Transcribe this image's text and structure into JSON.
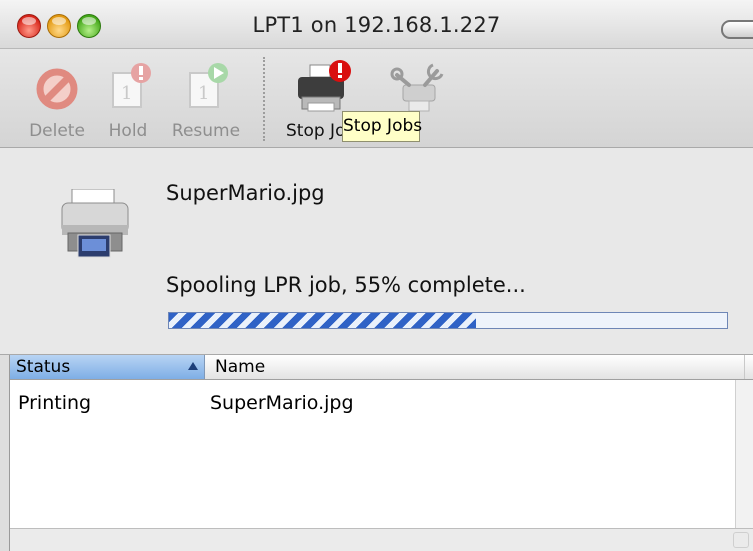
{
  "window": {
    "title": "LPT1 on 192.168.1.227"
  },
  "toolbar": {
    "delete_label": "Delete",
    "hold_label": "Hold",
    "resume_label": "Resume",
    "stop_jobs_label_visible": "Stop Jo",
    "tooltip": "Stop Jobs"
  },
  "job": {
    "name": "SuperMario.jpg",
    "status": "Spooling LPR job, 55% complete...",
    "progress": 0.55
  },
  "table": {
    "columns": [
      "Status",
      "Name"
    ],
    "sort_column": "Status",
    "rows": [
      {
        "status": "Printing",
        "name": "SuperMario.jpg"
      }
    ]
  },
  "colors": {
    "accent_header": "#7eaee5",
    "progress_stripe": "#2f62c6",
    "tooltip_bg": "#ffffc7",
    "stop_badge": "#d90f0f",
    "resume_badge": "#3aa53a"
  },
  "icons": {
    "delete": "no-entry-icon",
    "hold": "hold-job-icon",
    "resume": "resume-job-icon",
    "stop_jobs": "printer-stop-icon",
    "utility": "printer-utility-icon",
    "job_printer": "printer-icon"
  }
}
